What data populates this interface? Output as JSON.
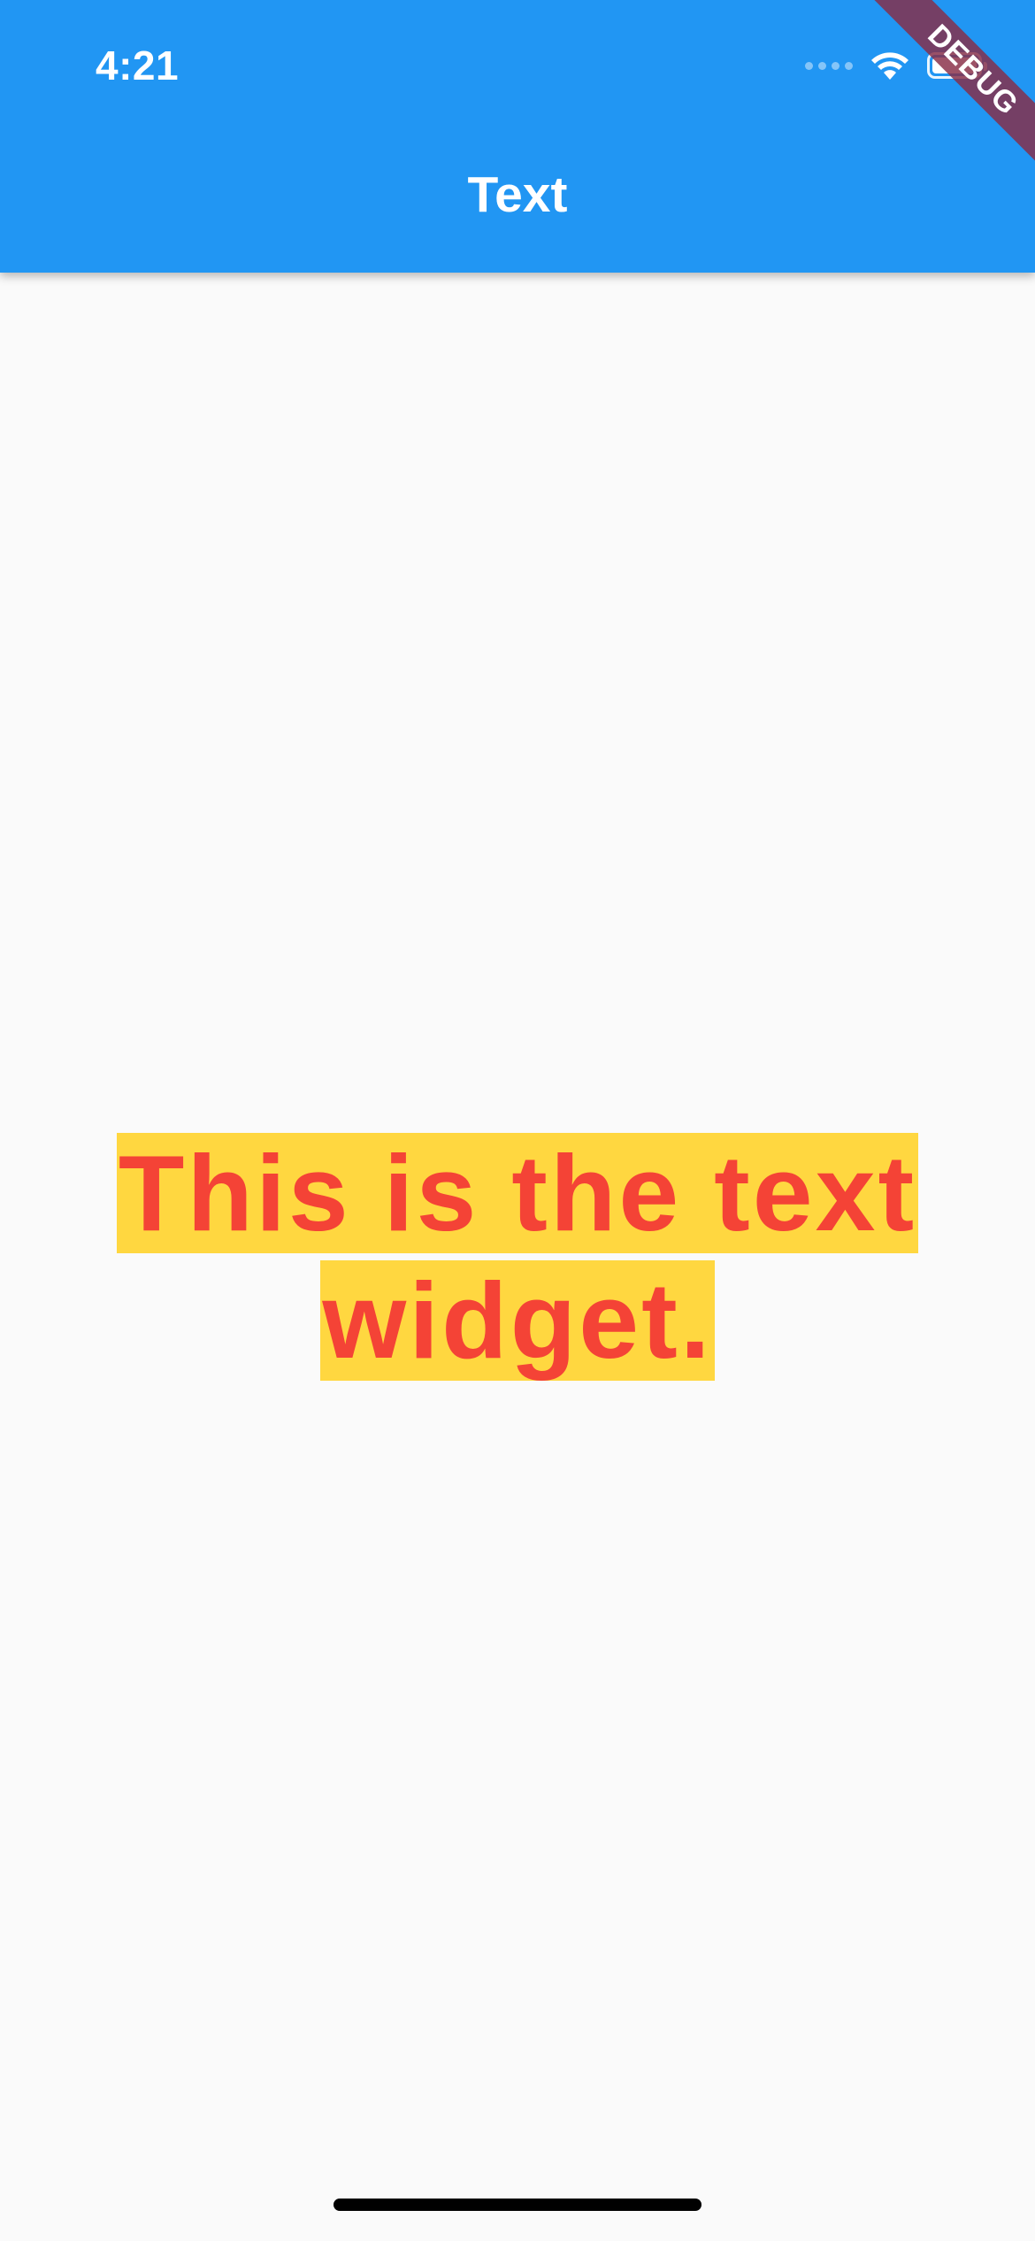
{
  "status_bar": {
    "time": "4:21",
    "icons": [
      "signal-dots-icon",
      "wifi-icon",
      "battery-icon"
    ]
  },
  "app_bar": {
    "title": "Text",
    "color": "#2196F3"
  },
  "debug_banner": {
    "label": "DEBUG",
    "color": "#882C46"
  },
  "content": {
    "text": "This is the text widget.",
    "text_color": "#F44336",
    "highlight_color": "#FFD740"
  }
}
